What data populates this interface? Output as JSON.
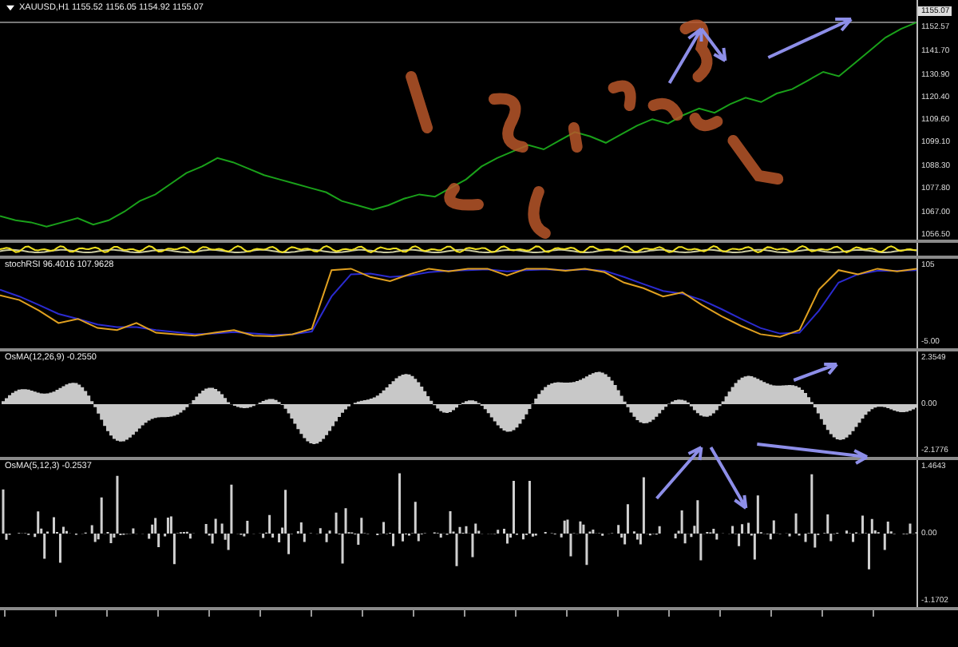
{
  "window": {
    "title": "XAUUSD,H1 1155.52 1156.05 1154.92 1155.07"
  },
  "current_price": "1155.07",
  "chart_data": {
    "type": "line",
    "ylim": [
      1054,
      1155.07
    ],
    "yticks": [
      {
        "value": 1152.57,
        "label": "1152.57"
      },
      {
        "value": 1141.7,
        "label": "1141.70"
      },
      {
        "value": 1130.9,
        "label": "1130.90"
      },
      {
        "value": 1120.4,
        "label": "1120.40"
      },
      {
        "value": 1109.6,
        "label": "1109.60"
      },
      {
        "value": 1099.1,
        "label": "1099.10"
      },
      {
        "value": 1088.3,
        "label": "1088.30"
      },
      {
        "value": 1077.8,
        "label": "1077.80"
      },
      {
        "value": 1067,
        "label": "1067.00"
      },
      {
        "value": 1056.5,
        "label": "1056.50"
      }
    ],
    "series": [
      {
        "color": "#1aa11a",
        "values": [
          1065,
          1063,
          1062,
          1060,
          1062,
          1064,
          1061,
          1063,
          1067,
          1072,
          1075,
          1080,
          1085,
          1088,
          1092,
          1090,
          1087,
          1084,
          1082,
          1080,
          1078,
          1076,
          1072,
          1070,
          1068,
          1070,
          1073,
          1075,
          1074,
          1078,
          1082,
          1088,
          1092,
          1095,
          1098,
          1096,
          1100,
          1104,
          1102,
          1099,
          1103,
          1107,
          1110,
          1108,
          1112,
          1115,
          1113,
          1117,
          1120,
          1118,
          1122,
          1124,
          1128,
          1132,
          1130,
          1136,
          1142,
          1148,
          1152,
          1155
        ]
      }
    ]
  },
  "panels": [
    {
      "kind": "band"
    },
    {
      "kind": "oscillator",
      "label": "stochRSI 96.4016 107.9628",
      "chart_data": {
        "type": "line",
        "ylim": [
          -5,
          105
        ],
        "yticks": [
          {
            "value": 105,
            "label": "105"
          },
          {
            "value": -5,
            "label": "-5.00"
          }
        ],
        "series": [
          {
            "color": "#2b2bd0",
            "values": [
              70,
              60,
              48,
              35,
              28,
              20,
              16,
              16,
              12,
              9,
              6,
              7,
              9,
              7,
              5,
              6,
              10,
              60,
              92,
              93,
              88,
              90,
              95,
              97,
              98,
              99,
              96,
              98,
              99,
              98,
              99,
              97,
              88,
              78,
              68,
              64,
              55,
              42,
              28,
              15,
              7,
              8,
              40,
              80,
              92,
              97,
              97,
              98
            ]
          },
          {
            "color": "#e0a020",
            "values": [
              62,
              55,
              40,
              22,
              28,
              15,
              12,
              22,
              8,
              6,
              4,
              8,
              12,
              4,
              3,
              6,
              14,
              98,
              100,
              88,
              82,
              92,
              100,
              96,
              100,
              100,
              90,
              100,
              100,
              97,
              100,
              95,
              80,
              72,
              60,
              66,
              48,
              32,
              18,
              6,
              2,
              12,
              70,
              98,
              92,
              100,
              96,
              100
            ]
          }
        ]
      }
    },
    {
      "kind": "histogram",
      "label": "OsMA(12,26,9) -0.2550",
      "axis": [
        "2.3549",
        "0.00",
        "-2.1776"
      ]
    },
    {
      "kind": "spikes",
      "label": "OsMA(5,12,3) -0.2537",
      "axis": [
        "1.4643",
        "0.00",
        "-1.1702"
      ]
    }
  ]
}
